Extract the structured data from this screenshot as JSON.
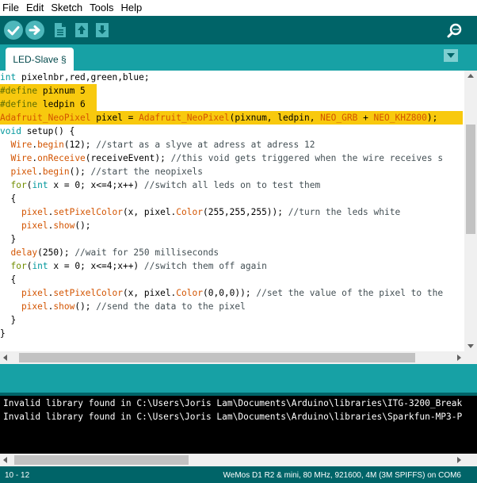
{
  "menu": {
    "items": [
      {
        "label": "File"
      },
      {
        "label": "Edit"
      },
      {
        "label": "Sketch"
      },
      {
        "label": "Tools"
      },
      {
        "label": "Help"
      }
    ]
  },
  "toolbar": {
    "buttons": [
      "verify-icon",
      "upload-icon",
      "new-icon",
      "open-icon",
      "save-icon"
    ],
    "serial_monitor": "serial-monitor-icon"
  },
  "tabs": {
    "active_label": "LED-Slave §",
    "menu_icon": "chevron-down-icon"
  },
  "code": {
    "l1_type": "int",
    "l1_rest": " pixelnbr,red,green,blue;",
    "l2_pre": "#define",
    "l2_rest": " pixnum 5",
    "l3_pre": "#define",
    "l3_rest": " ledpin 6",
    "l4_type": "Adafruit_NeoPixel",
    "l4_mid": " pixel = ",
    "l4_fn": "Adafruit_NeoPixel",
    "l4_args1": "(pixnum, ledpin, ",
    "l4_lit1": "NEO_GRB",
    "l4_plus": " + ",
    "l4_lit2": "NEO_KHZ800",
    "l4_end": ");",
    "l5_type": "void",
    "l5_fn": " setup",
    "l5_rest": "() {",
    "l6_obj": "  Wire",
    "l6_dot": ".",
    "l6_fn": "begin",
    "l6_args": "(12); ",
    "l6_cmt": "//start as a slyve at adress at adress 12",
    "l7_obj": "  Wire",
    "l7_dot": ".",
    "l7_fn": "onReceive",
    "l7_args": "(receiveEvent); ",
    "l7_cmt": "//this void gets triggered when the wire receives s",
    "l8_obj": "  pixel",
    "l8_dot": ".",
    "l8_fn": "begin",
    "l8_args": "(); ",
    "l8_cmt": "//start the neopixels",
    "l9_ctrl": "  for",
    "l9_p1": "(",
    "l9_type": "int",
    "l9_rest": " x = 0; x<=4;x++) ",
    "l9_cmt": "//switch all leds on to test them",
    "l10": "  {",
    "l11_obj": "    pixel",
    "l11_dot": ".",
    "l11_fn": "setPixelColor",
    "l11_a": "(x, pixel.",
    "l11_fn2": "Color",
    "l11_b": "(255,255,255)); ",
    "l11_cmt": "//turn the leds white",
    "l12_obj": "    pixel",
    "l12_dot": ".",
    "l12_fn": "show",
    "l12_rest": "();",
    "l13": "  }",
    "l14_fn": "  delay",
    "l14_args": "(250); ",
    "l14_cmt": "//wait for 250 milliseconds",
    "l15_ctrl": "  for",
    "l15_p1": "(",
    "l15_type": "int",
    "l15_rest": " x = 0; x<=4;x++) ",
    "l15_cmt": "//switch them off again",
    "l16": "  {",
    "l17_obj": "    pixel",
    "l17_dot": ".",
    "l17_fn": "setPixelColor",
    "l17_a": "(x, pixel.",
    "l17_fn2": "Color",
    "l17_b": "(0,0,0)); ",
    "l17_cmt": "//set the value of the pixel to the",
    "l18_obj": "    pixel",
    "l18_dot": ".",
    "l18_fn": "show",
    "l18_args": "(); ",
    "l18_cmt": "//send the data to the pixel",
    "l19": "  }",
    "l20": "}"
  },
  "console": {
    "lines": [
      "Invalid library found in C:\\Users\\Joris Lam\\Documents\\Arduino\\libraries\\ITG-3200_Break",
      "Invalid library found in C:\\Users\\Joris Lam\\Documents\\Arduino\\libraries\\Sparkfun-MP3-P"
    ]
  },
  "footer": {
    "line_range": "10 - 12",
    "board": "WeMos D1 R2 & mini, 80 MHz, 921600, 4M (3M SPIFFS) on COM6"
  },
  "colors": {
    "toolbar": "#006468",
    "tabstrip": "#17a1a5",
    "highlight": "#f8c90e",
    "keyword": "#00979c",
    "function": "#d35400"
  }
}
